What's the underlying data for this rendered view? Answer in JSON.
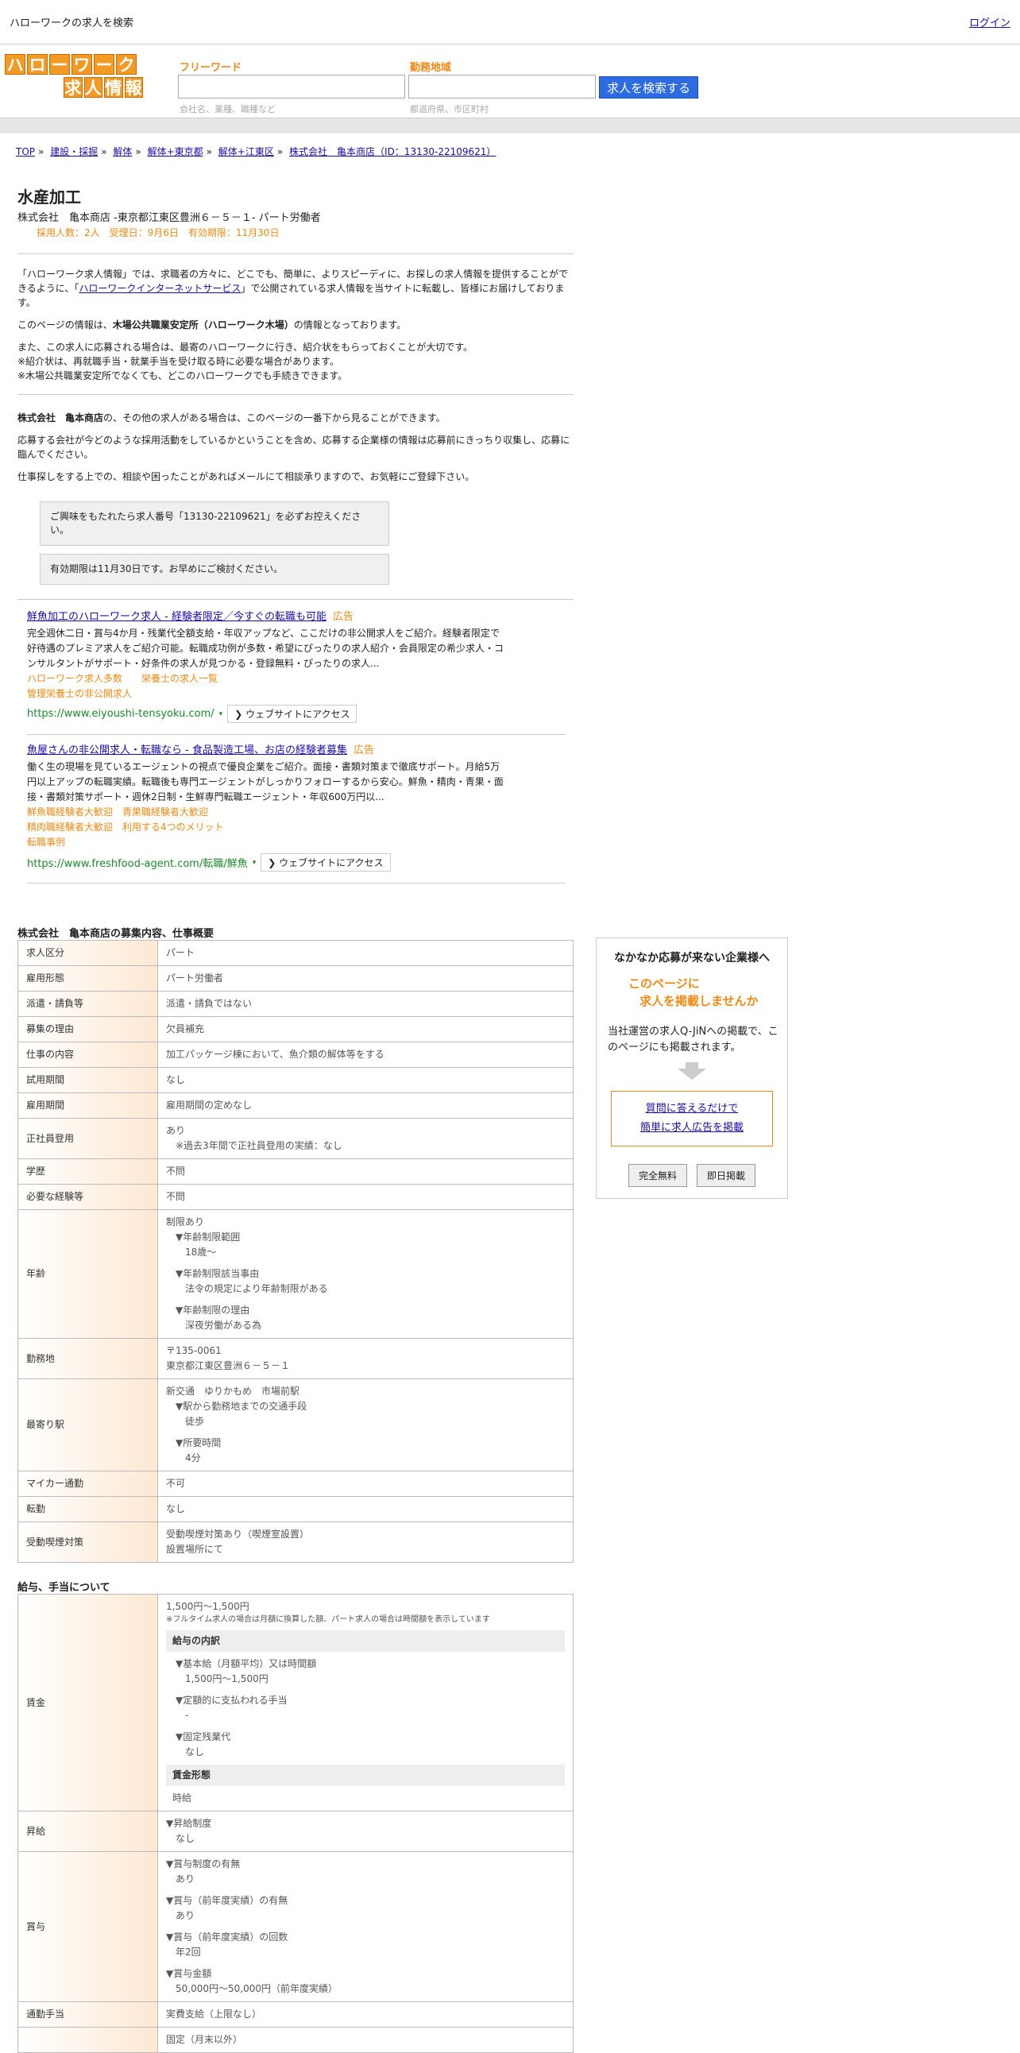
{
  "topbar": {
    "title": "ハローワークの求人を検索",
    "link": "ログイン"
  },
  "logo": {
    "row1": [
      "ハ",
      "ロ",
      "ー",
      "ワ",
      "ー",
      "ク"
    ],
    "row2": [
      "求",
      "人",
      "情",
      "報"
    ]
  },
  "search": {
    "keyword_label": "フリーワード",
    "keyword_placeholder": "会社名、業種、職種など",
    "area_label": "勤務地域",
    "area_placeholder": "都道府県、市区町村",
    "button": "求人を検索する"
  },
  "breadcrumb": [
    "TOP",
    "建設・採掘",
    "解体",
    "解体+東京都",
    "解体+江東区",
    "株式会社　亀本商店（ID：13130-22109621）"
  ],
  "job": {
    "title": "水産加工",
    "subtitle": "株式会社　亀本商店 -東京都江東区豊洲６－５－１- パート労働者",
    "meta": "採用人数：2人　受理日：9月6日　有効期限：11月30日"
  },
  "intro": {
    "p1a": "「ハローワーク求人情報」では、求職者の方々に、どこでも、簡単に、よりスピーディに、お探しの求人情報を提供することができるように、「",
    "p1link": "ハローワークインターネットサービス",
    "p1b": "」で公開されている求人情報を当サイトに転載し、皆様にお届けしております。",
    "p2a": "このページの情報は、",
    "p2bold": "木場公共職業安定所（ハローワーク木場）",
    "p2b": "の情報となっております。",
    "p3": "また、この求人に応募される場合は、最寄のハローワークに行き、紹介状をもらっておくことが大切です。",
    "p4": "※紹介状は、再就職手当・就業手当を受け取る時に必要な場合があります。",
    "p5": "※木場公共職業安定所でなくても、どこのハローワークでも手続きできます。",
    "p6bold": "株式会社　亀本商店",
    "p6": "の、その他の求人がある場合は、このページの一番下から見ることができます。",
    "p7": "応募する会社が今どのような採用活動をしているかということを含め、応募する企業様の情報は応募前にきっちり収集し、応募に臨んでください。",
    "p8": "仕事探しをする上での、相談や困ったことがあればメールにて相談承りますので、お気軽にご登録下さい。",
    "note1": "ご興味をもたれたら求人番号「13130-22109621」を必ずお控えください。",
    "note2": "有効期限は11月30日です。お早めにご検討ください。"
  },
  "ads": [
    {
      "title": "鮮魚加工のハローワーク求人 - 経験者限定／今すぐの転職も可能",
      "tag": "広告",
      "desc": "完全週休二日・賞与4か月・残業代全額支給・年収アップなど、ここだけの非公開求人をご紹介。経験者限定で好待遇のプレミア求人をご紹介可能。転職成功例が多数・希望にぴったりの求人紹介・会員限定の希少求人・コンサルタントがサポート・好条件の求人が見つかる・登録無料・ぴったりの求人...",
      "links": [
        "ハローワーク求人多数　　栄養士の求人一覧",
        "管理栄養士の非公開求人"
      ],
      "url": "https://www.eiyoushi-tensyoku.com/",
      "visit": "ウェブサイトにアクセス"
    },
    {
      "title": "魚屋さんの非公開求人・転職なら - 食品製造工場、お店の経験者募集",
      "tag": "広告",
      "desc": "働く生の現場を見ているエージェントの視点で優良企業をご紹介。面接・書類対策まで徹底サポート。月給5万円以上アップの転職実績。転職後も専門エージェントがしっかりフォローするから安心。鮮魚・精肉・青果・面接・書類対策サポート・週休2日制・生鮮専門転職エージェント・年収600万円以...",
      "links": [
        "鮮魚職経験者大歓迎　青果職経験者大歓迎",
        "精肉職経験者大歓迎　利用する4つのメリット",
        "転職事例"
      ],
      "url": "https://www.freshfood-agent.com/転職/鮮魚",
      "visit": "ウェブサイトにアクセス"
    }
  ],
  "details": {
    "title": "株式会社　亀本商店の募集内容、仕事概要",
    "rows": [
      {
        "k": "求人区分",
        "v": [
          "パート"
        ]
      },
      {
        "k": "雇用形態",
        "v": [
          "パート労働者"
        ]
      },
      {
        "k": "派遣・請負等",
        "v": [
          "派遣・請負ではない"
        ]
      },
      {
        "k": "募集の理由",
        "v": [
          "欠員補充"
        ]
      },
      {
        "k": "仕事の内容",
        "v": [
          "加工パッケージ棟において、魚介類の解体等をする"
        ]
      },
      {
        "k": "試用期間",
        "v": [
          "なし"
        ]
      },
      {
        "k": "雇用期間",
        "v": [
          "雇用期間の定めなし"
        ]
      },
      {
        "k": "正社員登用",
        "v": [
          "あり",
          "　※過去3年間で正社員登用の実績：なし"
        ]
      },
      {
        "k": "学歴",
        "v": [
          "不問"
        ]
      },
      {
        "k": "必要な経験等",
        "v": [
          "不問"
        ]
      },
      {
        "k": "年齢",
        "v": [
          "制限あり",
          "　▼年齢制限範囲",
          "　　18歳〜",
          "",
          "　▼年齢制限該当事由",
          "　　法令の規定により年齢制限がある",
          "",
          "　▼年齢制限の理由",
          "　　深夜労働がある為"
        ]
      },
      {
        "k": "勤務地",
        "v": [
          "〒135-0061",
          "東京都江東区豊洲６－５－１"
        ]
      },
      {
        "k": "最寄り駅",
        "v": [
          "新交通　ゆりかもめ　市場前駅",
          "　▼駅から勤務地までの交通手段",
          "　　徒歩",
          "",
          "　▼所要時間",
          "　　4分"
        ]
      },
      {
        "k": "マイカー通勤",
        "v": [
          "不可"
        ]
      },
      {
        "k": "転勤",
        "v": [
          "なし"
        ]
      },
      {
        "k": "受動喫煙対策",
        "v": [
          "受動喫煙対策あり（喫煙室設置）",
          "設置場所にて"
        ]
      }
    ]
  },
  "pay": {
    "title": "給与、手当について",
    "wage_label": "賃金",
    "wage_range": "1,500円〜1,500円",
    "wage_note": "※フルタイム求人の場合は月額に換算した額、パート求人の場合は時間額を表示しています",
    "breakdown_title": "給与の内訳",
    "breakdown": [
      "▼基本給（月額平均）又は時間額",
      "　1,500円〜1,500円",
      "",
      "▼定額的に支払われる手当",
      "　-",
      "",
      "▼固定残業代",
      "　なし"
    ],
    "form_title": "賃金形態",
    "form_value": "時給",
    "raise_label": "昇給",
    "raise": [
      "▼昇給制度",
      "　なし"
    ],
    "bonus_label": "賞与",
    "bonus": [
      "▼賞与制度の有無",
      "　あり",
      "",
      "▼賞与（前年度実績）の有無",
      "　あり",
      "",
      "▼賞与（前年度実績）の回数",
      "　年2回",
      "",
      "▼賞与金額",
      "　50,000円〜50,000円（前年度実績）"
    ],
    "commute_label": "通勤手当",
    "commute": "実費支給（上限なし）",
    "last": "固定（月末以外）"
  },
  "sidebar": {
    "title": "なかなか応募が来ない企業様へ",
    "catch1": "このページに",
    "catch2": "求人を掲載しませんか",
    "text": "当社運営の求人Q-JiNへの掲載で、このページにも掲載されます。",
    "link1": "質問に答えるだけで",
    "link2": "簡単に求人広告を掲載",
    "btn1": "完全無料",
    "btn2": "即日掲載"
  }
}
